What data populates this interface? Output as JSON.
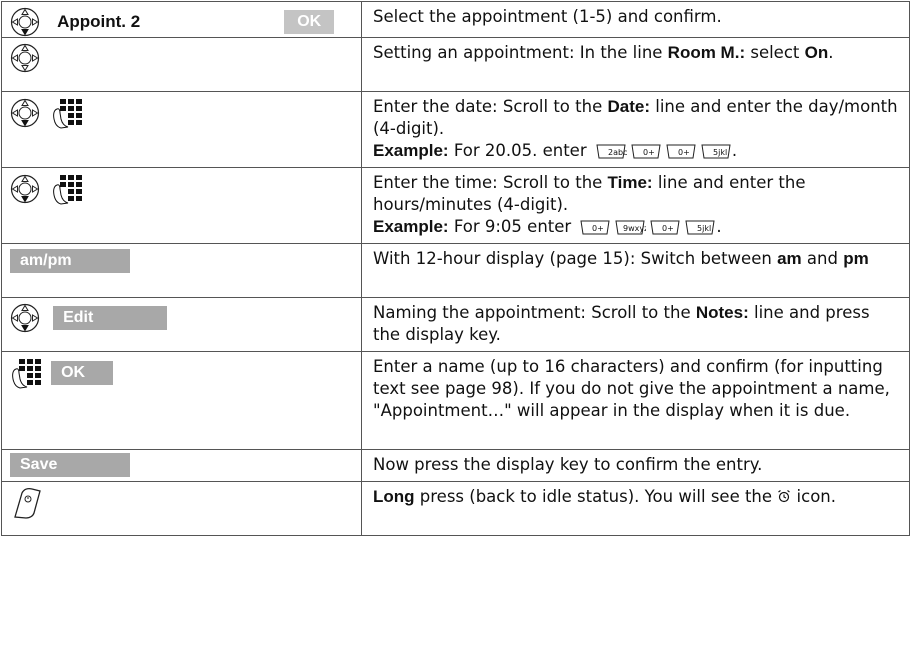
{
  "rows": [
    {
      "left": {
        "menu_label": "Appoint. 2",
        "key": "OK"
      },
      "text": "Select the appointment (1-5) and confirm."
    },
    {
      "text_a": "Setting an appointment: In the line ",
      "bold_1": "Room M.:",
      "text_b": " select ",
      "bold_2": "On",
      "text_c": "."
    },
    {
      "text_a": "Enter the date: Scroll to the ",
      "bold_1": "Date:",
      "text_b": " line and enter the day/month (4-digit).",
      "ex_label": "Example:",
      "ex_text": " For 20.05. enter ",
      "end": "."
    },
    {
      "text_a": "Enter the time: Scroll to the ",
      "bold_1": "Time:",
      "text_b": " line and enter the hours/minutes (4-digit).",
      "ex_label": "Example:",
      "ex_text": " For 9:05 enter ",
      "end": "."
    },
    {
      "left": {
        "key": "am/pm"
      },
      "text_a": "With 12-hour display (page 15): Switch between ",
      "bold_1": "am",
      "text_b": " and ",
      "bold_2": "pm"
    },
    {
      "left": {
        "key": "Edit"
      },
      "text_a": "Naming the appointment: Scroll to the ",
      "bold_1": "Notes:",
      "text_b": " line and press the display key."
    },
    {
      "left": {
        "key": "OK"
      },
      "text": "Enter a name (up to 16 characters) and confirm (for inputting text see page 98). If you do not give the appointment a name, \"Appointment…\" will appear in the display when it is due."
    },
    {
      "left": {
        "key": "Save"
      },
      "text": "Now press the display key to confirm the entry."
    },
    {
      "bold_1": "Long",
      "text_a": " press (back to idle status). You will see the ",
      "text_b": " icon."
    }
  ],
  "keys_date": [
    "2abc",
    "0+",
    "0+",
    "5jkl"
  ],
  "keys_time": [
    "0+",
    "9wxyz",
    "0+",
    "5jkl"
  ],
  "icons": {
    "nav": "control-key-icon",
    "keypad": "keypad-icon",
    "end": "end-call-key-icon",
    "alarm": "alarm-clock-icon"
  }
}
